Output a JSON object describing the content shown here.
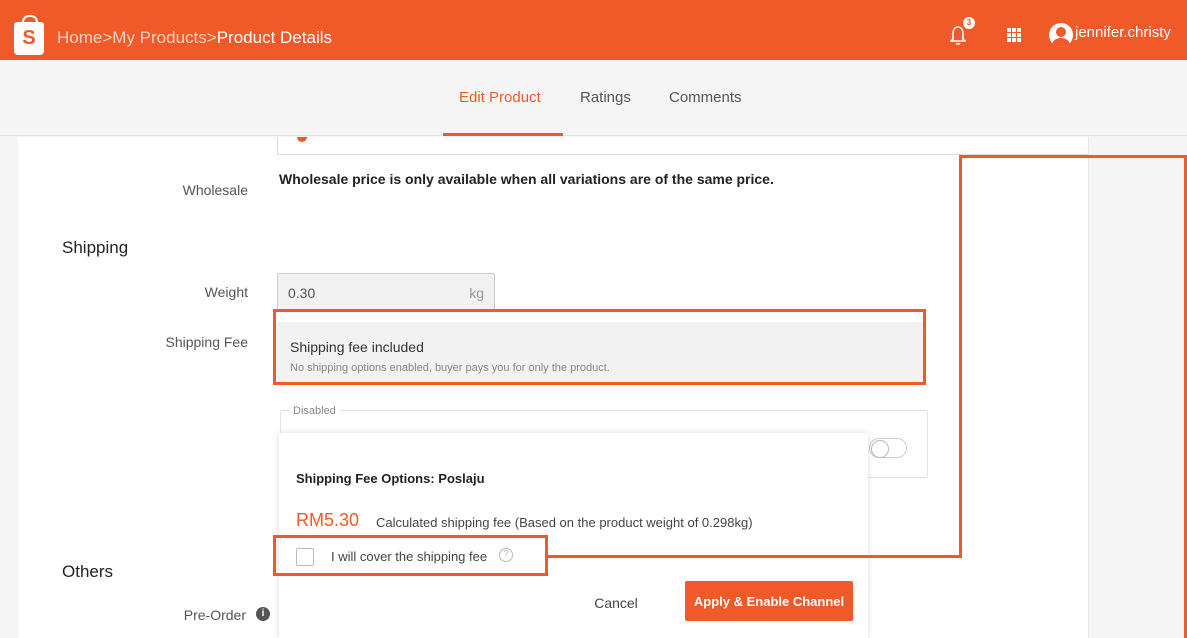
{
  "header": {
    "logo_letter": "S",
    "breadcrumb": [
      "Home",
      " >",
      "My Products",
      " >",
      "Product Details"
    ],
    "notification_count": "3",
    "username": "jennifer.christy"
  },
  "tabs": [
    {
      "label": "Edit Product",
      "active": true
    },
    {
      "label": "Ratings",
      "active": false
    },
    {
      "label": "Comments",
      "active": false
    }
  ],
  "form": {
    "wholesale_label": "Wholesale",
    "wholesale_note": "Wholesale price is only available when all variations are of the same price.",
    "shipping_section": "Shipping",
    "weight_label": "Weight",
    "weight_value": "0.30",
    "weight_unit": "kg",
    "shipping_fee_label": "Shipping Fee",
    "shipping_fee_title": "Shipping fee included",
    "shipping_fee_sub": "No shipping options enabled, buyer pays you for only the product.",
    "disabled_legend": "Disabled",
    "others_section": "Others",
    "preorder_label": "Pre-Order"
  },
  "popup": {
    "title": "Shipping Fee Options: Poslaju",
    "price": "RM5.30",
    "calculated_note": "Calculated shipping fee (Based on the product weight of 0.298kg)",
    "cover_label": "I will cover the shipping fee",
    "cancel_label": "Cancel",
    "apply_label": "Apply & Enable Channel"
  },
  "colors": {
    "accent": "#f05a28"
  }
}
